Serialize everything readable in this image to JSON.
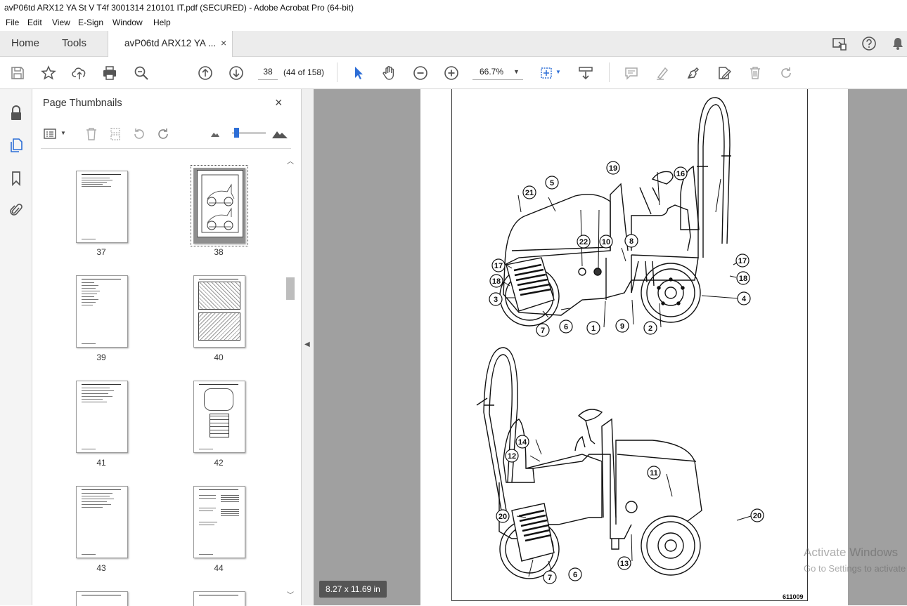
{
  "window": {
    "title": "avP06td ARX12 YA St V T4f 3001314 210101 IT.pdf (SECURED) - Adobe Acrobat Pro (64-bit)"
  },
  "menu": [
    "File",
    "Edit",
    "View",
    "E-Sign",
    "Window",
    "Help"
  ],
  "tabs": {
    "home": "Home",
    "tools": "Tools",
    "document": "avP06td ARX12 YA ...",
    "close": "×"
  },
  "toolbar": {
    "page_input": "38",
    "page_count": "(44 of 158)",
    "zoom": "66.7%"
  },
  "thumbnails_panel": {
    "title": "Page Thumbnails",
    "close": "×",
    "pages": [
      {
        "label": "37",
        "selected": false
      },
      {
        "label": "38",
        "selected": true
      },
      {
        "label": "39",
        "selected": false
      },
      {
        "label": "40",
        "selected": false
      },
      {
        "label": "41",
        "selected": false
      },
      {
        "label": "42",
        "selected": false
      },
      {
        "label": "43",
        "selected": false
      },
      {
        "label": "44",
        "selected": false
      }
    ]
  },
  "document": {
    "page_size": "8.27 x 11.69 in",
    "figure_code": "611009",
    "callouts_top": [
      "19",
      "16",
      "21",
      "5",
      "22",
      "10",
      "8",
      "17",
      "17",
      "18",
      "18",
      "3",
      "4",
      "7",
      "6",
      "1",
      "9",
      "2"
    ],
    "callouts_bottom": [
      "14",
      "12",
      "11",
      "20",
      "20",
      "13",
      "7",
      "6"
    ]
  },
  "watermark": {
    "line1": "Activate Windows",
    "line2": "Go to Settings to activate Windows."
  }
}
